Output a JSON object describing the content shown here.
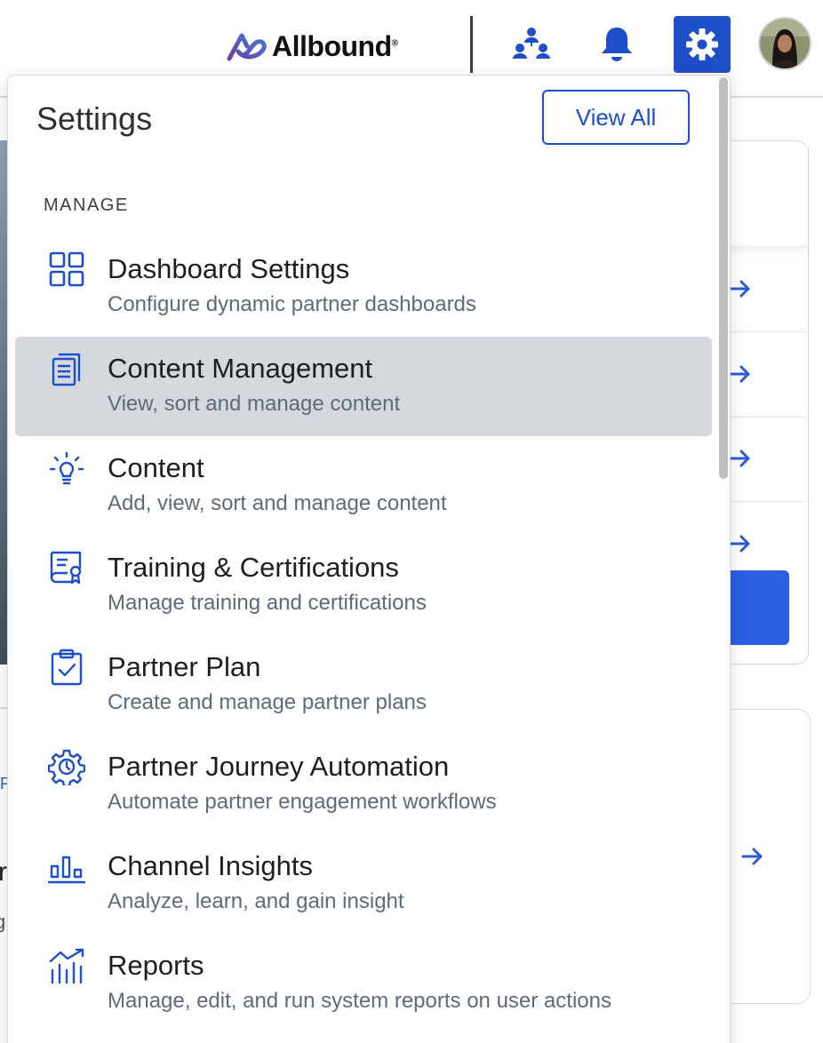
{
  "brand": {
    "logo_text": "Allbound",
    "registered_mark": "®"
  },
  "colors": {
    "accent": "#1f4fc8",
    "active_item_bg": "#d5d8dc",
    "description": "#5d6b7b"
  },
  "header_icons": [
    "org-chart-icon",
    "bell-icon",
    "gear-icon",
    "user-avatar"
  ],
  "settings_panel": {
    "title": "Settings",
    "view_all_label": "View All",
    "section_label": "MANAGE",
    "items": [
      {
        "icon": "dashboard-grid-icon",
        "title": "Dashboard Settings",
        "description": "Configure dynamic partner dashboards",
        "active": false
      },
      {
        "icon": "document-list-icon",
        "title": "Content Management",
        "description": "View, sort and manage content",
        "active": true
      },
      {
        "icon": "lightbulb-icon",
        "title": "Content",
        "description": "Add, view, sort and manage content",
        "active": false
      },
      {
        "icon": "certificate-icon",
        "title": "Training & Certifications",
        "description": "Manage training and certifications",
        "active": false
      },
      {
        "icon": "clipboard-check-icon",
        "title": "Partner Plan",
        "description": "Create and manage partner plans",
        "active": false
      },
      {
        "icon": "automation-gear-icon",
        "title": "Partner Journey Automation",
        "description": "Automate partner engagement workflows",
        "active": false
      },
      {
        "icon": "bar-chart-icon",
        "title": "Channel Insights",
        "description": "Analyze, learn, and gain insight",
        "active": false
      },
      {
        "icon": "report-chart-icon",
        "title": "Reports",
        "description": "Manage, edit, and run system reports on user actions",
        "active": false
      }
    ]
  },
  "background_fragments": {
    "letter_r": "r",
    "letter_g": "g",
    "letter_f": "F"
  }
}
